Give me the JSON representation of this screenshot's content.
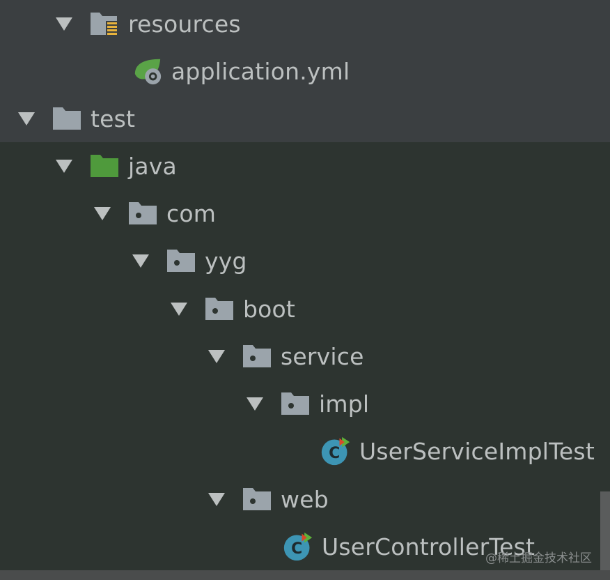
{
  "tree": {
    "nodes": [
      {
        "label": "resources",
        "icon": "resources-folder-icon",
        "expanded": true,
        "depth": 1
      },
      {
        "label": "application.yml",
        "icon": "spring-config-icon",
        "expanded": null,
        "depth": 2
      },
      {
        "label": "test",
        "icon": "folder-icon",
        "expanded": true,
        "depth": 0
      },
      {
        "label": "java",
        "icon": "test-sources-folder-icon",
        "expanded": true,
        "depth": 1
      },
      {
        "label": "com",
        "icon": "package-icon",
        "expanded": true,
        "depth": 2
      },
      {
        "label": "yyg",
        "icon": "package-icon",
        "expanded": true,
        "depth": 3
      },
      {
        "label": "boot",
        "icon": "package-icon",
        "expanded": true,
        "depth": 4
      },
      {
        "label": "service",
        "icon": "package-icon",
        "expanded": true,
        "depth": 5
      },
      {
        "label": "impl",
        "icon": "package-icon",
        "expanded": true,
        "depth": 6
      },
      {
        "label": "UserServiceImplTest",
        "icon": "test-class-icon",
        "expanded": null,
        "depth": 7
      },
      {
        "label": "web",
        "icon": "package-icon",
        "expanded": true,
        "depth": 5
      },
      {
        "label": "UserControllerTest",
        "icon": "test-class-icon",
        "expanded": null,
        "depth": 6
      }
    ]
  },
  "watermark": {
    "text": "@稀土掘金技术社区"
  },
  "colors": {
    "top_band": "#3b3f41",
    "bottom_band": "#2d3430",
    "text": "#bcc0c0",
    "folder": "#9ba4ab",
    "test_folder": "#4f9a3c",
    "class_icon": "#3d95b4",
    "run_marker": "#d84a2a"
  }
}
